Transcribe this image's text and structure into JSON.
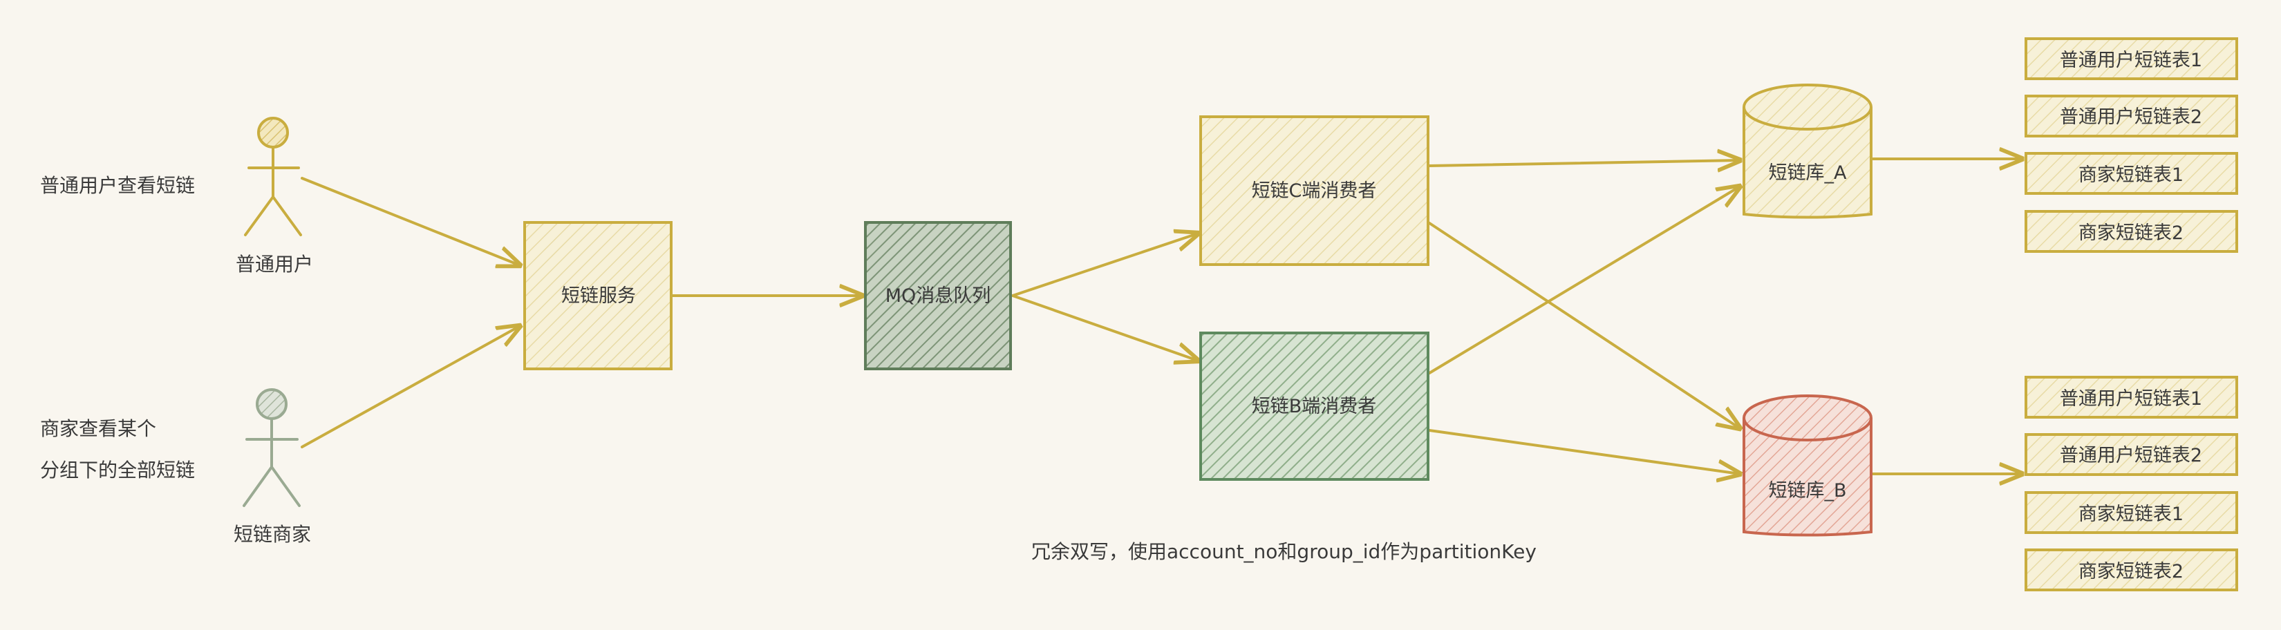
{
  "colors": {
    "background": "#f9f6ef",
    "yellow_stroke": "#c9ad3f",
    "yellow_fill": "#f5efd2",
    "green_stroke": "#5e8a5e",
    "green_fill": "#c9dcc5",
    "dark_green_stroke": "#5f7d5a",
    "sage_stroke": "#9aaa92",
    "red_stroke": "#c8664e",
    "red_fill": "#f1d6cf",
    "text": "#3a3a3a"
  },
  "actors": {
    "user": {
      "label": "普通用户",
      "icon": "person-icon",
      "description": "普通用户查看短链"
    },
    "merchant": {
      "label": "短链商家",
      "icon": "person-icon",
      "description_line1": "商家查看某个",
      "description_line2": "分组下的全部短链"
    }
  },
  "nodes": {
    "service": "短链服务",
    "mq": "MQ消息队列",
    "consumer_c": "短链C端消费者",
    "consumer_b": "短链B端消费者",
    "db_a": "短链库_A",
    "db_b": "短链库_B"
  },
  "tables_a": [
    "普通用户短链表1",
    "普通用户短链表2",
    "商家短链表1",
    "商家短链表2"
  ],
  "tables_b": [
    "普通用户短链表1",
    "普通用户短链表2",
    "商家短链表1",
    "商家短链表2"
  ],
  "note": "冗余双写，使用account_no和group_id作为partitionKey"
}
